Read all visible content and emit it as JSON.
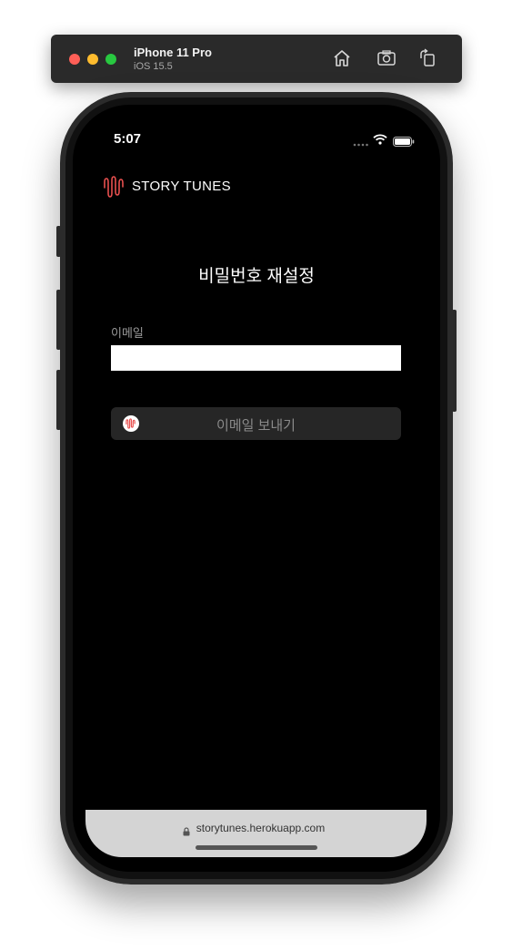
{
  "simulator": {
    "device_name": "iPhone 11 Pro",
    "os_version": "iOS 15.5",
    "icons": [
      "home-icon",
      "screenshot-icon",
      "rotate-icon"
    ]
  },
  "status_bar": {
    "time": "5:07"
  },
  "app": {
    "logo_text": "STORY TUNES",
    "page_title": "비밀번호 재설정",
    "email_label": "이메일",
    "email_value": "",
    "send_button_label": "이메일 보내기",
    "accent_color": "#e8504f"
  },
  "browser": {
    "url": "storytunes.herokuapp.com"
  }
}
